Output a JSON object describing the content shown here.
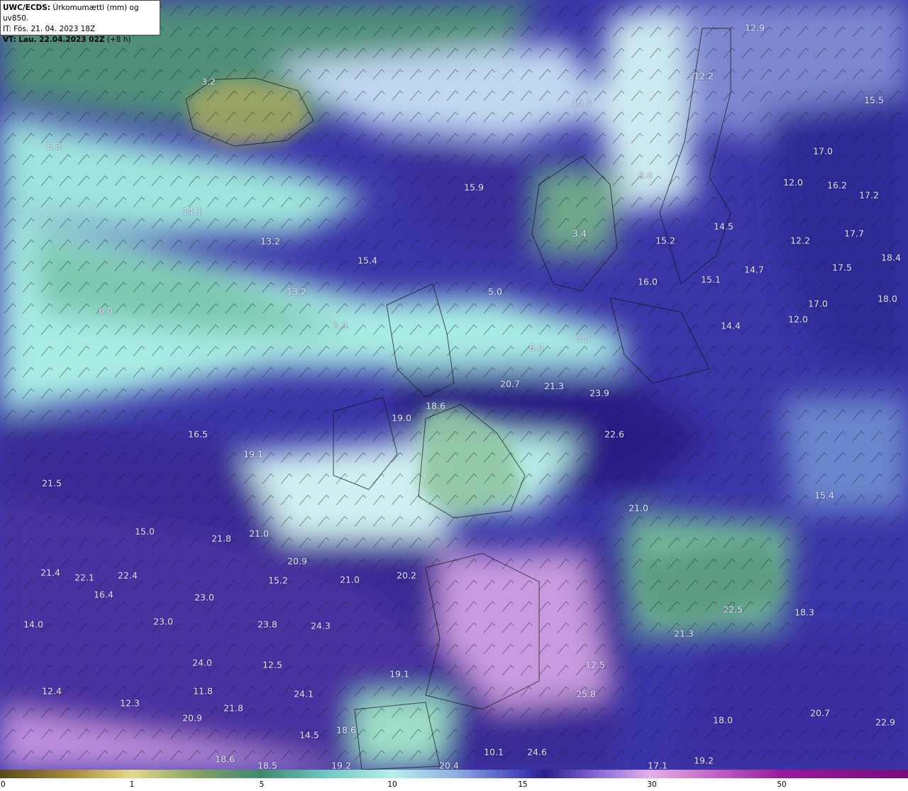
{
  "header": {
    "model": "UWC/ECDS:",
    "title": "Úrkomumætti (mm) og uv850.",
    "init_time": "IT: Fös. 21. 04. 2023 18Z",
    "valid_label": "VT:",
    "valid_time": "Lau. 22.04.2023 02Z",
    "lead": "(+8 h)"
  },
  "colors": {
    "dry": "#6f9a6a",
    "low": "#b8ece6",
    "mid": "#5a5ac8",
    "high": "#2c2388",
    "very_high": "#9a78d8",
    "extreme": "#d8a0e0"
  },
  "colorbar": {
    "ticks": [
      "0",
      "1",
      "5",
      "10",
      "15",
      "30",
      "50"
    ]
  },
  "values": [
    {
      "t": "3.2"
    },
    {
      "t": "12.9"
    },
    {
      "t": "15.5"
    },
    {
      "t": "15.5"
    },
    {
      "t": "12.2"
    },
    {
      "t": "6.3"
    },
    {
      "t": "17.0"
    },
    {
      "t": "6.0"
    },
    {
      "t": "12.0"
    },
    {
      "t": "16.2"
    },
    {
      "t": "17.2"
    },
    {
      "t": "15.9"
    },
    {
      "t": "14.1"
    },
    {
      "t": "14.5"
    },
    {
      "t": "3.4"
    },
    {
      "t": "17.7"
    },
    {
      "t": "13.2"
    },
    {
      "t": "15.2"
    },
    {
      "t": "12.2"
    },
    {
      "t": "15.4"
    },
    {
      "t": "14.7"
    },
    {
      "t": "17.5"
    },
    {
      "t": "18.4"
    },
    {
      "t": "13.2"
    },
    {
      "t": "5.0"
    },
    {
      "t": "16.0"
    },
    {
      "t": "15.1"
    },
    {
      "t": "17.0"
    },
    {
      "t": "18.0"
    },
    {
      "t": "6.0"
    },
    {
      "t": "12.0"
    },
    {
      "t": "5.5"
    },
    {
      "t": "14.4"
    },
    {
      "t": "5.5"
    },
    {
      "t": "6.0"
    },
    {
      "t": "20.7"
    },
    {
      "t": "21.3"
    },
    {
      "t": "23.9"
    },
    {
      "t": "18.6"
    },
    {
      "t": "19.0"
    },
    {
      "t": "22.6"
    },
    {
      "t": "16.5"
    },
    {
      "t": "19.1"
    },
    {
      "t": "21.5"
    },
    {
      "t": "15.4"
    },
    {
      "t": "21.0"
    },
    {
      "t": "15.0"
    },
    {
      "t": "21.0"
    },
    {
      "t": "21.8"
    },
    {
      "t": "20.9"
    },
    {
      "t": "21.4"
    },
    {
      "t": "22.1"
    },
    {
      "t": "22.4"
    },
    {
      "t": "15.2"
    },
    {
      "t": "21.0"
    },
    {
      "t": "20.2"
    },
    {
      "t": "16.4"
    },
    {
      "t": "23.0"
    },
    {
      "t": "14.0"
    },
    {
      "t": "23.0"
    },
    {
      "t": "23.8"
    },
    {
      "t": "24.3"
    },
    {
      "t": "22.5"
    },
    {
      "t": "18.3"
    },
    {
      "t": "21.3"
    },
    {
      "t": "24.0"
    },
    {
      "t": "12.5"
    },
    {
      "t": "12.5"
    },
    {
      "t": "19.1"
    },
    {
      "t": "12.4"
    },
    {
      "t": "11.8"
    },
    {
      "t": "24.1"
    },
    {
      "t": "25.8"
    },
    {
      "t": "12.3"
    },
    {
      "t": "21.8"
    },
    {
      "t": "20.9"
    },
    {
      "t": "18.0"
    },
    {
      "t": "20.7"
    },
    {
      "t": "14.5"
    },
    {
      "t": "18.6"
    },
    {
      "t": "22.9"
    },
    {
      "t": "10.1"
    },
    {
      "t": "24.6"
    },
    {
      "t": "18.6"
    },
    {
      "t": "18.5"
    },
    {
      "t": "19.2"
    },
    {
      "t": "20.4"
    },
    {
      "t": "17.1"
    },
    {
      "t": "19.2"
    }
  ]
}
